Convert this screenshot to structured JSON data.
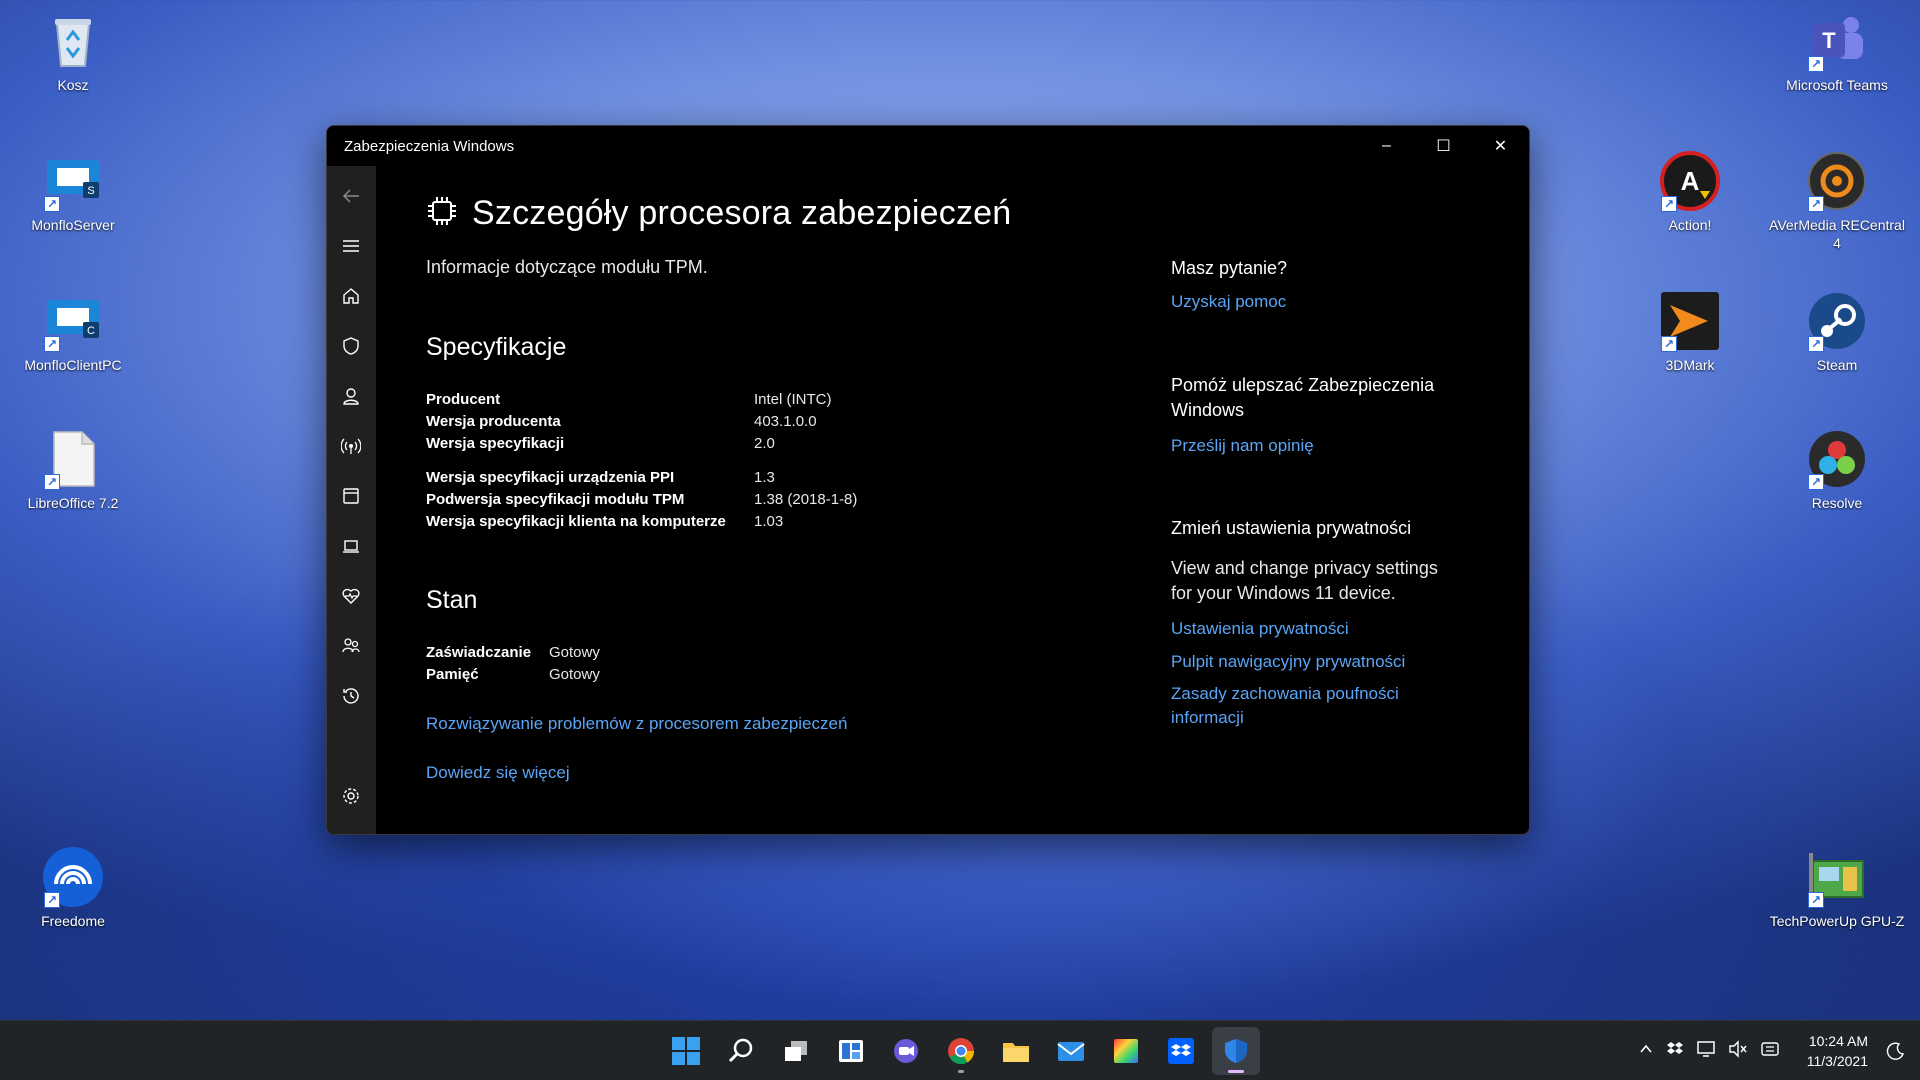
{
  "desktop": {
    "left_icons": [
      {
        "label": "Kosz",
        "icon": "recycle-bin-icon"
      },
      {
        "label": "MonfloServer",
        "icon": "monflo-server-icon"
      },
      {
        "label": "MonfloClientPC",
        "icon": "monflo-client-icon"
      },
      {
        "label": "LibreOffice 7.2",
        "icon": "libreoffice-icon"
      },
      {
        "label": "Freedome",
        "icon": "freedome-icon"
      }
    ],
    "right_icons": [
      {
        "label": "Microsoft Teams",
        "icon": "teams-icon"
      },
      {
        "label": "Action!",
        "icon": "action-icon"
      },
      {
        "label": "AVerMedia RECentral 4",
        "icon": "avermedia-icon"
      },
      {
        "label": "3DMark",
        "icon": "3dmark-icon"
      },
      {
        "label": "Steam",
        "icon": "steam-icon"
      },
      {
        "label": "Resolve",
        "icon": "resolve-icon"
      },
      {
        "label": "TechPowerUp GPU-Z",
        "icon": "gpuz-icon"
      }
    ]
  },
  "window": {
    "title": "Zabezpieczenia Windows",
    "controls": {
      "minimize": "–",
      "maximize": "☐",
      "close": "✕"
    }
  },
  "sidebar": {
    "items": [
      "back-icon",
      "menu-icon",
      "home-icon",
      "shield-icon",
      "account-icon",
      "firewall-icon",
      "app-browser-icon",
      "device-security-icon",
      "device-health-icon",
      "family-icon",
      "history-icon",
      "settings-icon"
    ]
  },
  "page": {
    "title": "Szczegóły procesora zabezpieczeń",
    "subtitle": "Informacje dotyczące modułu TPM.",
    "spec_heading": "Specyfikacje",
    "specs": [
      {
        "key": "Producent",
        "value": "Intel (INTC)"
      },
      {
        "key": "Wersja producenta",
        "value": "403.1.0.0"
      },
      {
        "key": "Wersja specyfikacji",
        "value": "2.0"
      },
      {
        "key": "Wersja specyfikacji urządzenia PPI",
        "value": "1.3"
      },
      {
        "key": "Podwersja specyfikacji modułu TPM",
        "value": "1.38 (2018-1-8)"
      },
      {
        "key": "Wersja specyfikacji klienta na komputerze",
        "value": "1.03"
      }
    ],
    "stan_heading": "Stan",
    "stan": [
      {
        "key": "Zaświadczanie",
        "value": "Gotowy"
      },
      {
        "key": "Pamięć",
        "value": "Gotowy"
      }
    ],
    "troubleshoot_link": "Rozwiązywanie problemów z procesorem zabezpieczeń",
    "learn_more_link": "Dowiedz się więcej"
  },
  "right_panel": {
    "question_heading": "Masz pytanie?",
    "help_link": "Uzyskaj pomoc",
    "improve_heading_1": "Pomóż ulepszać Zabezpieczenia",
    "improve_heading_2": "Windows",
    "feedback_link": "Prześlij nam opinię",
    "privacy_heading": "Zmień ustawienia prywatności",
    "privacy_text_1": "View and change privacy settings",
    "privacy_text_2": "for your Windows 11 device.",
    "privacy_settings_link": "Ustawienia prywatności",
    "privacy_dashboard_link": "Pulpit nawigacyjny prywatności",
    "privacy_policy_link_1": "Zasady zachowania poufności",
    "privacy_policy_link_2": "informacji"
  },
  "taskbar": {
    "apps": [
      "start-icon",
      "search-icon",
      "task-view-icon",
      "widgets-icon",
      "chat-icon",
      "chrome-icon",
      "file-explorer-icon",
      "mail-icon",
      "color-app-icon",
      "dropbox-icon",
      "windows-security-icon"
    ],
    "time": "10:24 AM",
    "date": "11/3/2021"
  },
  "colors": {
    "accent_link": "#5aa5f5",
    "window_bg": "#000000",
    "sidebar_bg": "#202020",
    "taskbar_bg": "#202427"
  }
}
